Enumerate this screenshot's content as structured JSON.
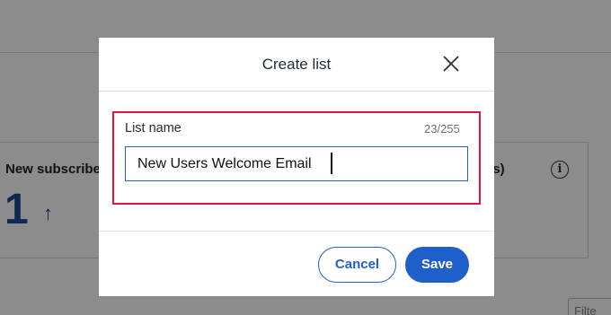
{
  "background": {
    "card_left_title": "New subscribe",
    "card_left_value": "1",
    "card_left_trend_icon": "arrow-up-icon",
    "card_right_title": "ys)",
    "info_icon": "info-icon",
    "filter_label": "Filte"
  },
  "modal": {
    "title": "Create list",
    "close_icon": "close-icon",
    "field": {
      "label": "List name",
      "char_count": "23/255",
      "value": "New Users Welcome Email"
    },
    "cancel_label": "Cancel",
    "save_label": "Save"
  },
  "colors": {
    "accent": "#1f5fcc",
    "highlight": "#e0143c",
    "overlay": "rgba(0,0,0,0.45)"
  }
}
